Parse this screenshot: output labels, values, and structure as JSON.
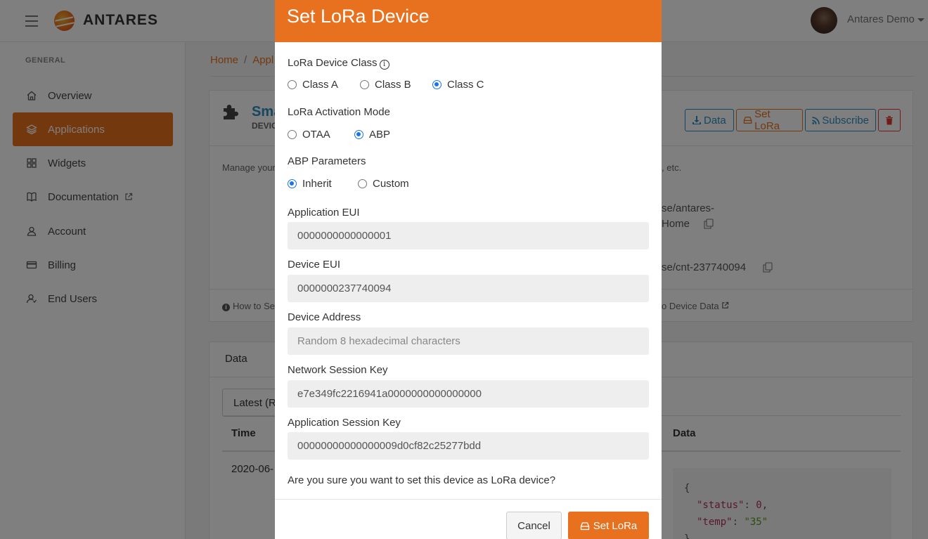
{
  "topbar": {
    "brand": "ANTARES",
    "user_name": "Antares Demo"
  },
  "sidebar": {
    "heading": "GENERAL",
    "items": [
      {
        "label": "Overview",
        "icon": "home-icon"
      },
      {
        "label": "Applications",
        "icon": "layers-icon",
        "active": true
      },
      {
        "label": "Widgets",
        "icon": "grid-icon"
      },
      {
        "label": "Documentation",
        "icon": "book-icon",
        "external": true
      },
      {
        "label": "Account",
        "icon": "user-icon"
      },
      {
        "label": "Billing",
        "icon": "credit-card-icon"
      },
      {
        "label": "End Users",
        "icon": "users-icon"
      }
    ]
  },
  "breadcrumb": {
    "home": "Home",
    "separator": "/",
    "current": "Appl"
  },
  "device_card": {
    "title": "Sma",
    "subtitle": "DEVIC",
    "buttons": {
      "data": "Data",
      "set_lora": "Set LoRa",
      "subscribe": "Subscribe"
    },
    "manage_text": "Manage your",
    "etc_text": ", etc.",
    "path_text_1": "se/antares-",
    "path_text_2": "Home",
    "path_text_3": "se/cnt-237740094",
    "help_left": "How to Se",
    "help_right": "o Device Data"
  },
  "data_card": {
    "tab": "Data",
    "select_value": "Latest (Re",
    "columns": {
      "time": "Time",
      "data": "Data"
    },
    "row_time": "2020-06-",
    "code_lines": {
      "open": "{",
      "status_key": "\"status\"",
      "status_val": "0",
      "temp_key": "\"temp\"",
      "temp_val": "\"35\"",
      "close": "}"
    }
  },
  "modal": {
    "title": "Set LoRa Device",
    "device_class": {
      "label": "LoRa Device Class",
      "info": "i",
      "options": [
        "Class A",
        "Class B",
        "Class C"
      ],
      "selected": "Class C"
    },
    "activation_mode": {
      "label": "LoRa Activation Mode",
      "options": [
        "OTAA",
        "ABP"
      ],
      "selected": "ABP"
    },
    "abp_parameters": {
      "label": "ABP Parameters",
      "options": [
        "Inherit",
        "Custom"
      ],
      "selected": "Inherit"
    },
    "fields": {
      "app_eui": {
        "label": "Application EUI",
        "value": "0000000000000001"
      },
      "device_eui": {
        "label": "Device EUI",
        "value": "0000000237740094"
      },
      "device_address": {
        "label": "Device Address",
        "placeholder": "Random 8 hexadecimal characters"
      },
      "network_session_key": {
        "label": "Network Session Key",
        "value": "e7e349fc2216941a0000000000000000"
      },
      "app_session_key": {
        "label": "Application Session Key",
        "value": "00000000000000009d0cf82c25277bdd"
      }
    },
    "confirm_text": "Are you sure you want to set this device as LoRa device?",
    "cancel_label": "Cancel",
    "submit_label": "Set LoRa"
  },
  "colors": {
    "accent": "#e8711f",
    "link": "#2a8fc2",
    "danger": "#e53935",
    "radio_checked": "#1a73e8"
  }
}
